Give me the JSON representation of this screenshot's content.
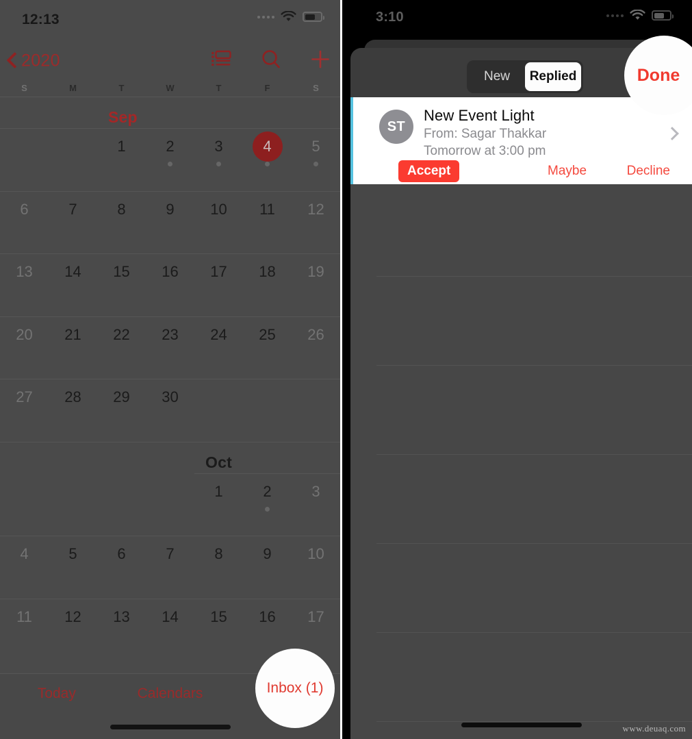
{
  "left_phone": {
    "status_bar": {
      "time": "12:13",
      "wifi_icon": "wifi-icon",
      "battery_icon": "battery-icon",
      "signal_icon": "signal-dots-icon"
    },
    "nav_bar": {
      "back_label": "2020",
      "back_icon": "chevron-left-icon",
      "list_view_icon": "day-list-view-icon",
      "search_icon": "search-icon",
      "add_icon": "plus-icon"
    },
    "weekday_headers": [
      "S",
      "M",
      "T",
      "W",
      "T",
      "F",
      "S"
    ],
    "weekend_indices": [
      0,
      6
    ],
    "months": [
      {
        "label": "Sep",
        "is_current": true,
        "first_weekday_index": 2,
        "weeks": [
          [
            null,
            null,
            1,
            2,
            3,
            4,
            5
          ],
          [
            6,
            7,
            8,
            9,
            10,
            11,
            12
          ],
          [
            13,
            14,
            15,
            16,
            17,
            18,
            19
          ],
          [
            20,
            21,
            22,
            23,
            24,
            25,
            26
          ],
          [
            27,
            28,
            29,
            30,
            null,
            null,
            null
          ]
        ],
        "selected_day": 4,
        "event_dot_days": [
          2,
          3,
          4,
          5
        ]
      },
      {
        "label": "Oct",
        "is_current": false,
        "first_weekday_index": 4,
        "weeks": [
          [
            null,
            null,
            null,
            null,
            1,
            2,
            3
          ],
          [
            4,
            5,
            6,
            7,
            8,
            9,
            10
          ],
          [
            11,
            12,
            13,
            14,
            15,
            16,
            17
          ]
        ],
        "selected_day": null,
        "event_dot_days": [
          2
        ]
      }
    ],
    "tab_bar": {
      "today": "Today",
      "calendars": "Calendars",
      "inbox": "Inbox (1)"
    },
    "highlight_target": "Inbox (1)"
  },
  "right_phone": {
    "status_bar": {
      "time": "3:10",
      "wifi_icon": "wifi-icon",
      "battery_icon": "battery-icon",
      "signal_icon": "signal-dots-icon"
    },
    "segmented_control": {
      "options": [
        "New",
        "Replied"
      ],
      "selected": "Replied"
    },
    "done_button": "Done",
    "highlight_target": "Done",
    "invitation_card": {
      "avatar_initials": "ST",
      "title": "New Event Light",
      "from_line": "From: Sagar Thakkar",
      "time_line": "Tomorrow at 3:00 pm",
      "disclosure_icon": "chevron-right-icon",
      "actions": {
        "accept": "Accept",
        "maybe": "Maybe",
        "decline": "Decline"
      }
    }
  },
  "watermark": "www.deuaq.com",
  "colors": {
    "accent_red": "#9b2b2b",
    "selected_day_bg": "#8d1f1f",
    "accept_red": "#fb3b30",
    "card_accent_blue": "#56c2e0",
    "avatar_gray": "#8e8e93",
    "dim_overlay_bg": "#4a4a4a"
  }
}
